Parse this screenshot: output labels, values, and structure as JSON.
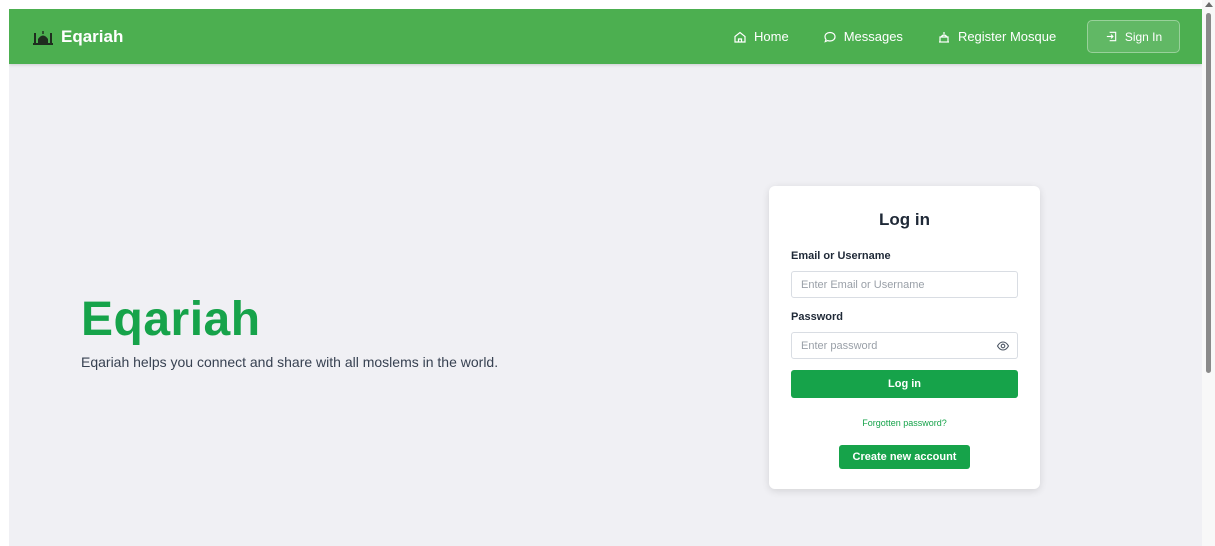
{
  "navbar": {
    "brand_name": "Eqariah",
    "brand_icon": "mosque-icon",
    "links": [
      {
        "label": "Home",
        "icon": "home-icon"
      },
      {
        "label": "Messages",
        "icon": "message-icon"
      },
      {
        "label": "Register Mosque",
        "icon": "mosque-outline-icon"
      }
    ],
    "signin_label": "Sign In",
    "signin_icon": "sign-in-icon",
    "background_color": "#4caf50"
  },
  "hero": {
    "title": "Eqariah",
    "subtitle": "Eqariah helps you connect and share with all moslems in the world.",
    "title_color": "#16a34a"
  },
  "login_card": {
    "title": "Log in",
    "email_label": "Email or Username",
    "email_placeholder": "Enter Email or Username",
    "email_value": "",
    "password_label": "Password",
    "password_placeholder": "Enter password",
    "password_value": "",
    "submit_label": "Log in",
    "forgot_label": "Forgotten password?",
    "create_account_label": "Create new account",
    "accent_color": "#16a34a"
  }
}
